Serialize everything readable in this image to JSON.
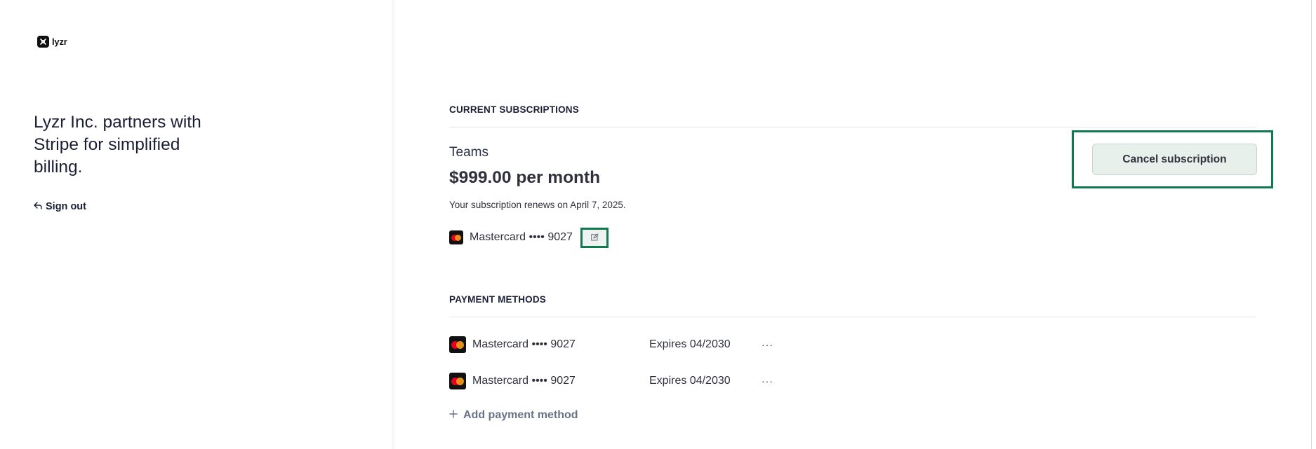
{
  "brand": {
    "logo_text": "lyzr"
  },
  "sidebar": {
    "tagline": "Lyzr Inc. partners with Stripe for simplified billing.",
    "sign_out": "Sign out"
  },
  "subscriptions": {
    "section_title": "CURRENT SUBSCRIPTIONS",
    "plan_name": "Teams",
    "price": "$999.00 per month",
    "renewal": "Your subscription renews on April 7, 2025.",
    "card_label": "Mastercard •••• 9027",
    "cancel_label": "Cancel subscription",
    "edit_icon": "edit-icon"
  },
  "payment_methods": {
    "section_title": "PAYMENT METHODS",
    "items": [
      {
        "label": "Mastercard •••• 9027",
        "expiry": "Expires 04/2030",
        "more": "···"
      },
      {
        "label": "Mastercard •••• 9027",
        "expiry": "Expires 04/2030",
        "more": "···"
      }
    ],
    "add_label": "Add payment method"
  },
  "colors": {
    "highlight": "#0f7a4d",
    "text": "#30313d",
    "muted": "#697386"
  }
}
